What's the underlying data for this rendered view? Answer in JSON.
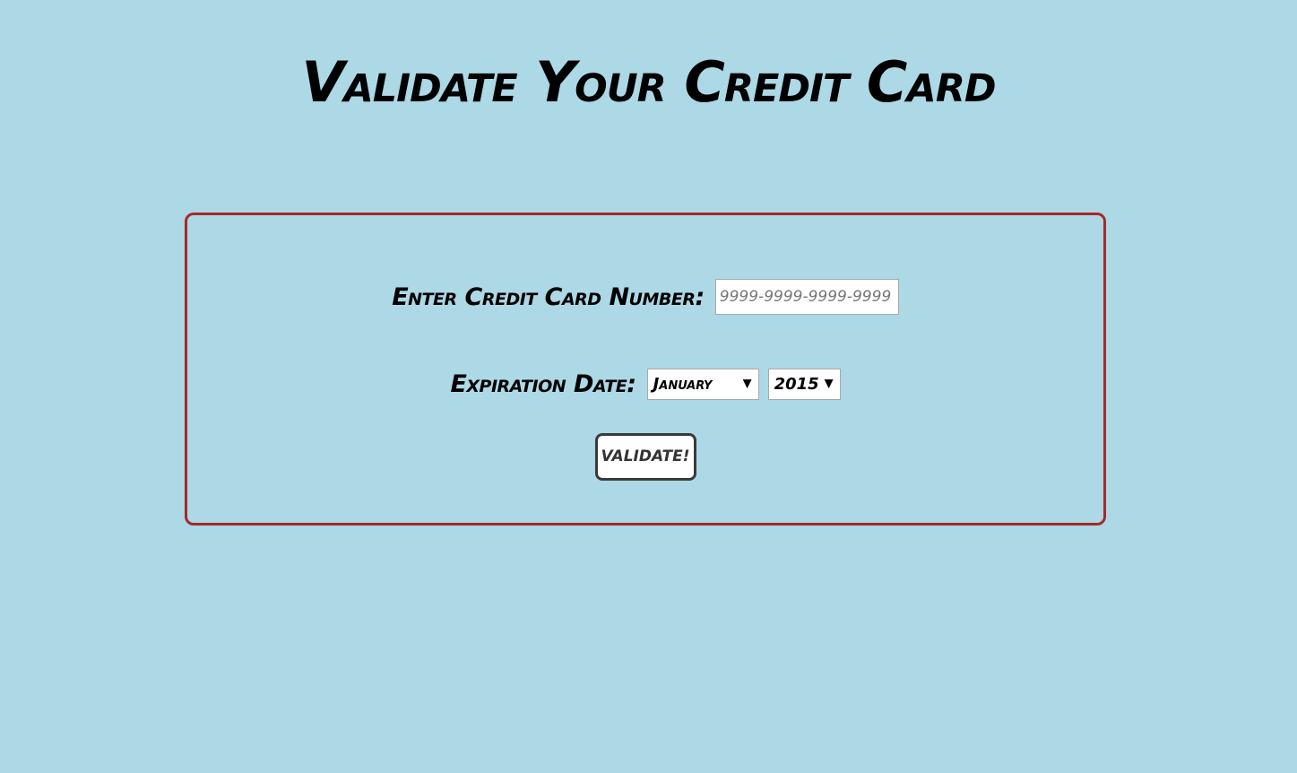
{
  "page": {
    "title": "Validate Your Credit Card"
  },
  "form": {
    "card_label": "Enter Credit Card Number:",
    "card_placeholder": "9999-9999-9999-9999",
    "card_value": "",
    "expiry_label": "Expiration Date:",
    "expiry_month": {
      "selected": "January"
    },
    "expiry_year": {
      "selected": "2015"
    },
    "dropdown_arrow": "▼",
    "submit_label": "VALIDATE!"
  },
  "colors": {
    "background": "#add8e6",
    "panel_border": "#a52a2a",
    "button_border": "#3a3a3a"
  }
}
